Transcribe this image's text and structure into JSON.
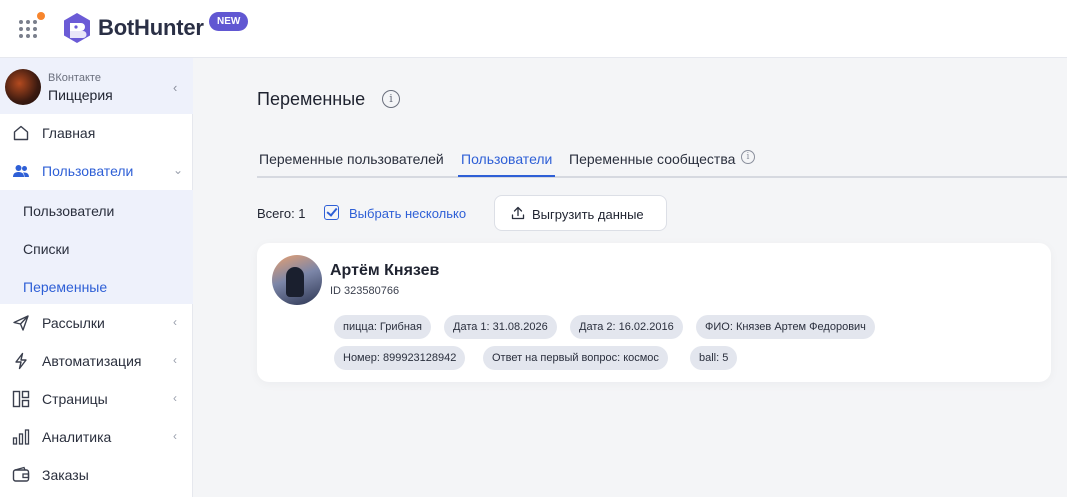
{
  "topbar": {
    "brand": "BotHunter",
    "badge": "NEW"
  },
  "sidebar": {
    "community": {
      "network": "ВКонтакте",
      "name": "Пиццерия"
    },
    "items": [
      {
        "label": "Главная",
        "icon": "home-icon"
      },
      {
        "label": "Пользователи",
        "icon": "users-icon"
      },
      {
        "label": "Рассылки",
        "icon": "send-icon"
      },
      {
        "label": "Автоматизация",
        "icon": "bolt-icon"
      },
      {
        "label": "Страницы",
        "icon": "pages-icon"
      },
      {
        "label": "Аналитика",
        "icon": "chart-icon"
      },
      {
        "label": "Заказы",
        "icon": "wallet-icon"
      }
    ],
    "subitems": [
      {
        "label": "Пользователи"
      },
      {
        "label": "Списки"
      },
      {
        "label": "Переменные"
      }
    ]
  },
  "main": {
    "title": "Переменные",
    "tabs": [
      {
        "label": "Переменные пользователей"
      },
      {
        "label": "Пользователи"
      },
      {
        "label": "Переменные сообщества"
      }
    ],
    "total": "Всего: 1",
    "select_many": "Выбрать несколько",
    "export": "Выгрузить данные",
    "user": {
      "name": "Артём Князев",
      "id": "ID 323580766",
      "chips": [
        "пицца: Грибная",
        "Дата 1: 31.08.2026",
        "Дата 2: 16.02.2016",
        "ФИО: Князев Артем Федорович",
        "Номер: 899923128942",
        "Ответ на первый вопрос: космос",
        "ball: 5"
      ]
    }
  },
  "colors": {
    "accent": "#2e5fd6",
    "badge": "#6157d2",
    "notification": "#f7852d"
  }
}
